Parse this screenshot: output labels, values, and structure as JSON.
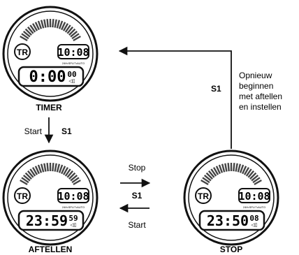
{
  "colors": {
    "ink": "#111111",
    "face": "#ffffff",
    "tick": "#444444"
  },
  "watches": [
    {
      "name": "timer",
      "caption": "TIMER",
      "icon": "TR",
      "clock": "10:08",
      "mode": "24H•SPLIT•AUTO",
      "main": "0:00",
      "sub": "00"
    },
    {
      "name": "aftellen",
      "caption": "AFTELLEN",
      "icon": "TR",
      "clock": "10:08",
      "mode": "24H•SPLIT•AUTO",
      "main": "23:59",
      "sub": "59"
    },
    {
      "name": "stop",
      "caption": "STOP",
      "icon": "TR",
      "clock": "10:08",
      "mode": "24H•SPLIT•AUTO",
      "main": "23:50",
      "sub": "08"
    }
  ],
  "transitions": {
    "timer_to_aftellen": {
      "word": "Start",
      "button": "S1"
    },
    "aftellen_to_stop": {
      "word": "Stop",
      "button": "S1"
    },
    "stop_to_aftellen": {
      "word": "Start"
    },
    "stop_to_timer": {
      "button": "S1",
      "note": [
        "Opnieuw",
        "beginnen",
        "met aftellen",
        "en instellen"
      ]
    }
  }
}
